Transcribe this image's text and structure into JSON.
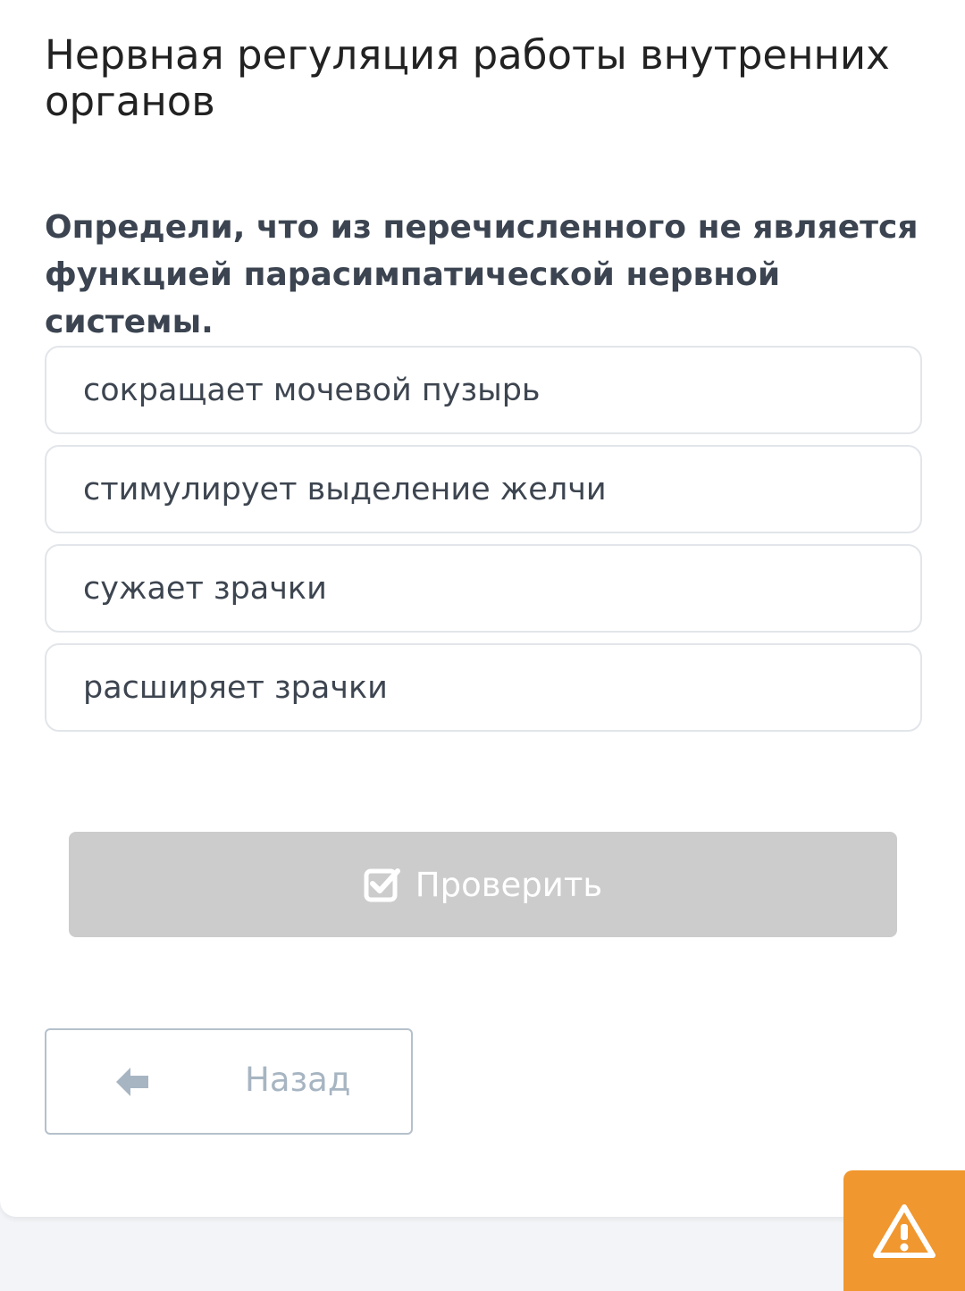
{
  "lesson": {
    "title": "Нервная регуляция работы внутренних органов"
  },
  "question": {
    "text": "Определи, что из перечисленного не является функцией парасимпатической нервной системы."
  },
  "options": [
    {
      "label": "сокращает мочевой пузырь"
    },
    {
      "label": "стимулирует выделение желчи"
    },
    {
      "label": "сужает зрачки"
    },
    {
      "label": "расширяет зрачки"
    }
  ],
  "actions": {
    "check_label": "Проверить",
    "check_icon": "checkbox-check-icon",
    "back_label": "Назад",
    "back_icon": "arrow-left-icon",
    "report_icon": "warning-icon"
  },
  "colors": {
    "check_button_disabled": "#cccccc",
    "report_button": "#f0972f",
    "back_border": "#b5c0cb"
  }
}
